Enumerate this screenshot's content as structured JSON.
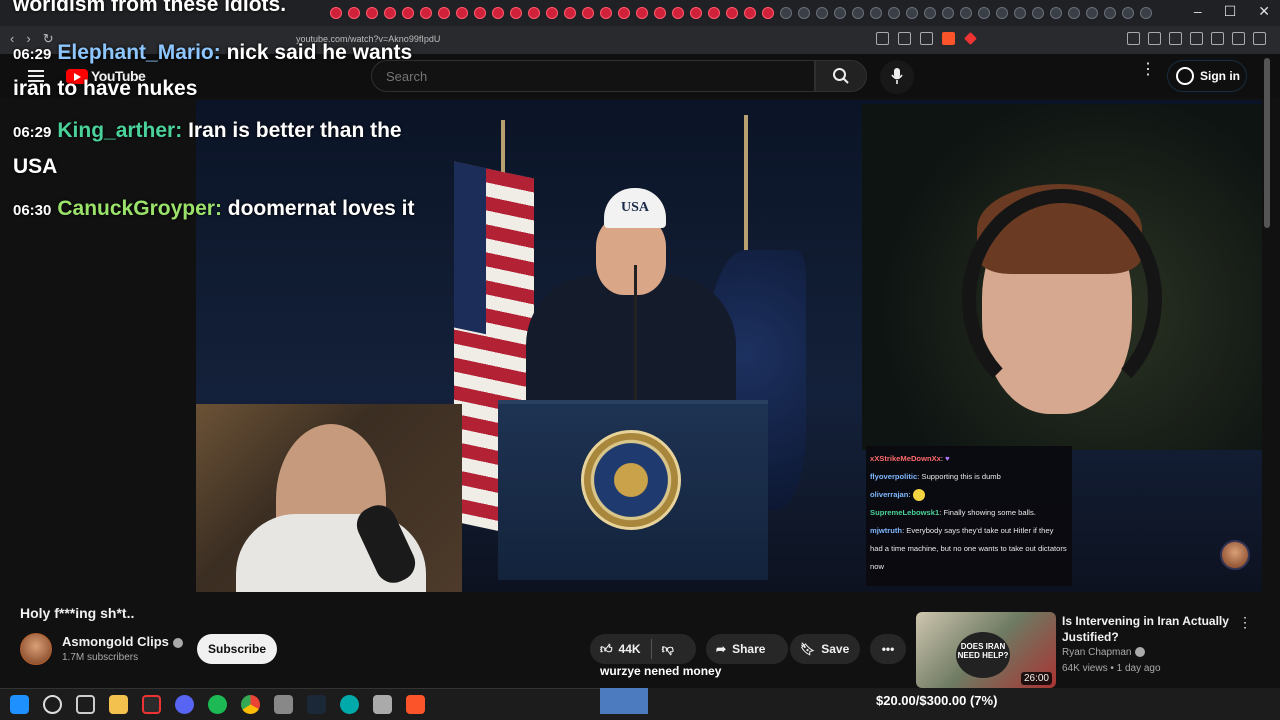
{
  "browser": {
    "url": "youtube.com/watch?v=Akno99fIpdU",
    "window_controls": [
      "–",
      "☐",
      "✕"
    ]
  },
  "youtube": {
    "logo_text": "YouTube",
    "search_placeholder": "Search",
    "signin_label": "Sign in"
  },
  "stream_chat": {
    "cut_top_line": "worldism from these idiots.",
    "messages": [
      {
        "time": "06:29",
        "user": "Elephant_Mario",
        "text": "nick said he wants iran to have nukes"
      },
      {
        "time": "06:29",
        "user": "King_arther",
        "text": "Iran is better than the USA"
      },
      {
        "time": "06:30",
        "user": "CanuckGroyper",
        "text": "doomernat loves it"
      }
    ]
  },
  "video_scene": {
    "cap_text": "USA"
  },
  "overlay_chat": [
    {
      "user": "xXStrikeMeDownXx",
      "text": "",
      "color": "#ff6a6a"
    },
    {
      "user": "flyoverpolitic",
      "text": "Supporting this is dumb",
      "color": "#7fb7ff"
    },
    {
      "user": "oliverrajan",
      "text": "",
      "color": "#7fb7ff"
    },
    {
      "user": "SupremeLebowsk1",
      "text": "Finally showing some balls.",
      "color": "#4ad29a"
    },
    {
      "user": "mjwtruth",
      "text": "Everybody says they'd take out Hitler if they had a time machine, but no one wants to take out dictators now",
      "color": "#7fb7ff"
    }
  ],
  "video_meta": {
    "title": "Holy f***ing sh*t..",
    "channel": "Asmongold Clips",
    "subscribers": "1.7M subscribers",
    "subscribe_label": "Subscribe",
    "likes": "44K",
    "share_label": "Share",
    "save_label": "Save",
    "ticker_text": "wurzye nened money"
  },
  "recommended": {
    "thumb_text": "DOES IRAN NEED HELP?",
    "duration": "26:00",
    "title": "Is Intervening in Iran Actually Justified?",
    "channel": "Ryan Chapman",
    "meta": "64K views • 1 day ago"
  },
  "donation_goal": {
    "label": "$20.00/$300.00 (7%)",
    "progress_fraction": 0.07
  },
  "colors": {
    "accent_red": "#ff0000",
    "goal_fill": "#4d7bbf"
  }
}
